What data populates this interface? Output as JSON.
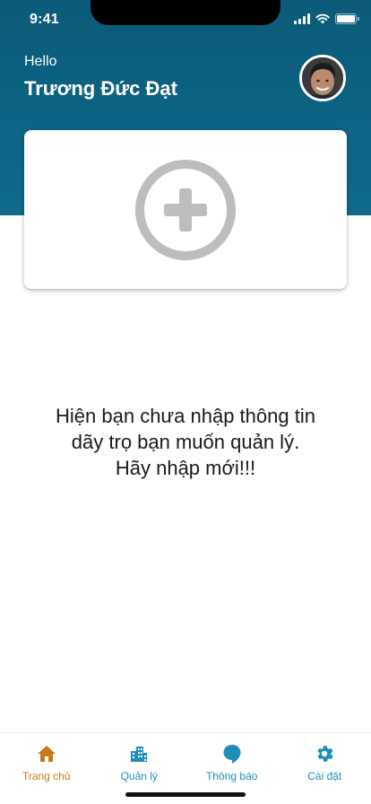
{
  "status_bar": {
    "time": "9:41"
  },
  "header": {
    "greeting": "Hello",
    "user_name": "Trương Đức Đạt"
  },
  "empty_state": {
    "line1": "Hiện bạn chưa nhập thông tin",
    "line2": "dãy trọ bạn muốn quản lý.",
    "line3": "Hãy nhập mới!!!"
  },
  "bottom_nav": {
    "items": [
      {
        "label": "Trang chủ",
        "icon": "home-icon",
        "active": true
      },
      {
        "label": "Quản lý",
        "icon": "building-icon",
        "active": false
      },
      {
        "label": "Thông báo",
        "icon": "chat-bubble-icon",
        "active": false
      },
      {
        "label": "Cài đặt",
        "icon": "gear-icon",
        "active": false
      }
    ]
  },
  "colors": {
    "header": "#0f6a8c",
    "active_nav": "#c67a1a",
    "inactive_nav": "#1e8fb8",
    "add_icon": "#bdbdbd"
  }
}
